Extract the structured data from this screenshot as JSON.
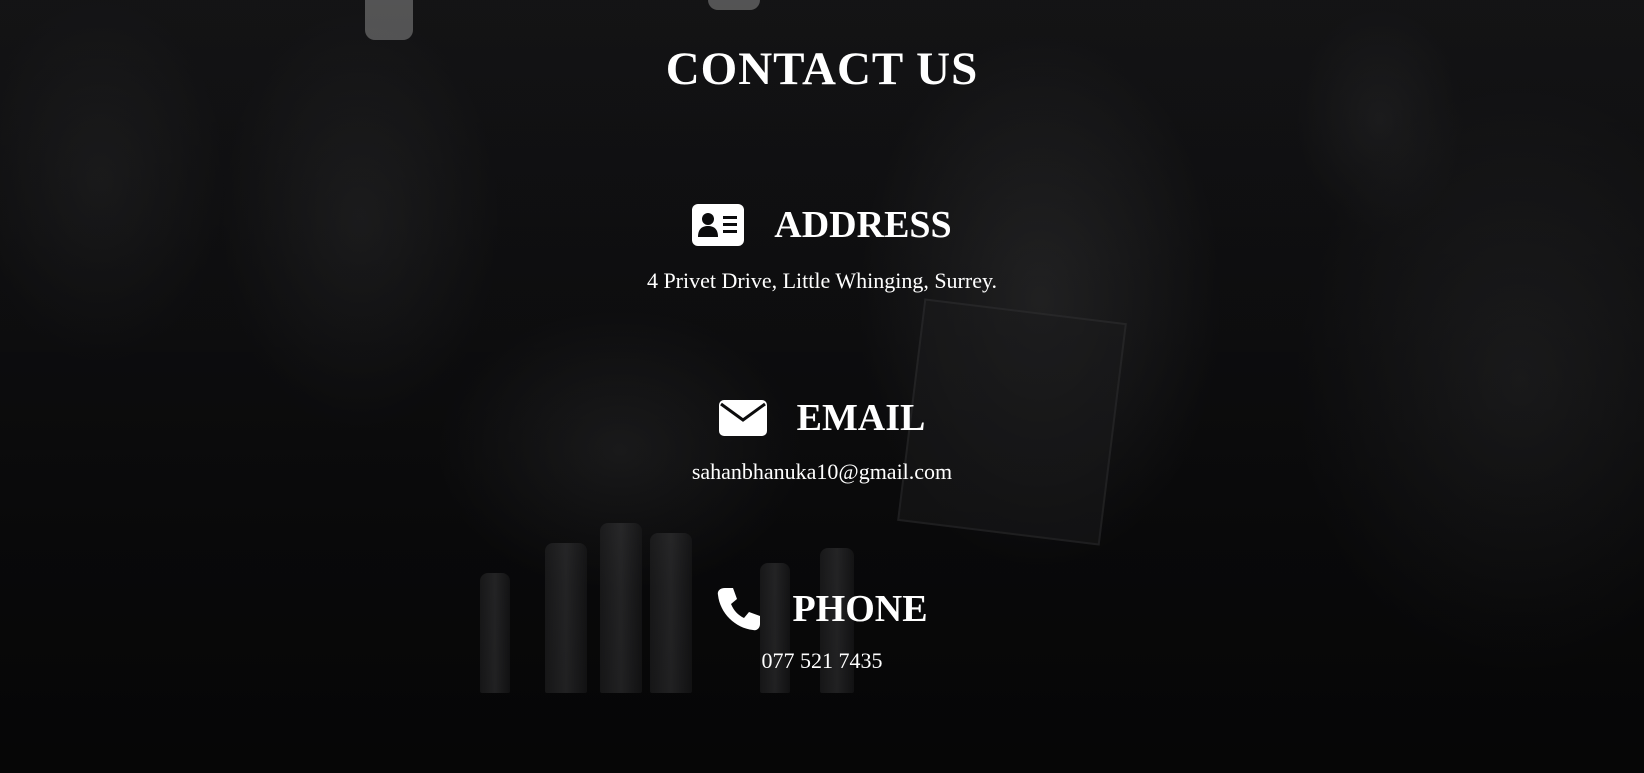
{
  "page": {
    "title": "CONTACT US"
  },
  "sections": [
    {
      "icon": "address-card-icon",
      "heading": "ADDRESS",
      "text": "4 Privet Drive, Little Whinging, Surrey."
    },
    {
      "icon": "envelope-icon",
      "heading": "EMAIL",
      "text": "sahanbhanuka10@gmail.com"
    },
    {
      "icon": "phone-icon",
      "heading": "PHONE",
      "text": "077 521 7435"
    }
  ],
  "colors": {
    "text": "#ffffff",
    "background": "#0b0b0c"
  }
}
